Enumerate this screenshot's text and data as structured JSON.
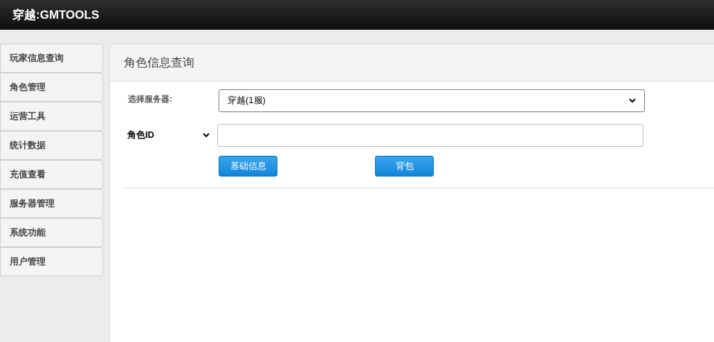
{
  "header": {
    "title": "穿越:GMTOOLS"
  },
  "sidebar": {
    "items": [
      {
        "label": "玩家信息查询",
        "selected": false
      },
      {
        "label": "角色管理",
        "selected": false
      },
      {
        "label": "运营工具",
        "selected": false
      },
      {
        "label": "统计数据",
        "selected": false
      },
      {
        "label": "充值查看",
        "selected": false
      },
      {
        "label": "服务器管理",
        "selected": false
      },
      {
        "label": "系统功能",
        "selected": false
      },
      {
        "label": "用户管理",
        "selected": false
      }
    ]
  },
  "panel": {
    "title": "角色信息查询",
    "server": {
      "label": "选择服务器:",
      "value": "穿越(1服)"
    },
    "query": {
      "type_value": "角色ID"
    },
    "buttons": [
      "基础信息",
      "背包"
    ]
  }
}
